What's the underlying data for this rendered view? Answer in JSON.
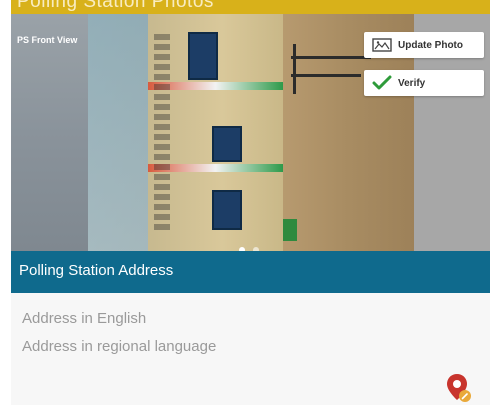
{
  "header": {
    "title": "Polling Station Photos"
  },
  "photo": {
    "label": "PS Front View",
    "carousel": {
      "count": 2,
      "active_index": 0
    }
  },
  "actions": {
    "update_photo": "Update Photo",
    "verify": "Verify"
  },
  "address_section": {
    "title": "Polling Station Address",
    "english_placeholder": "Address in English",
    "regional_placeholder": "Address in regional language"
  },
  "colors": {
    "header_bg": "#d8b11a",
    "section_header_bg": "#0f6a8d",
    "verify_check": "#2e9b3a",
    "pin_red": "#c8342d"
  },
  "icons": {
    "update_photo": "image-icon",
    "verify": "checkmark-icon",
    "location": "map-pin-icon"
  }
}
